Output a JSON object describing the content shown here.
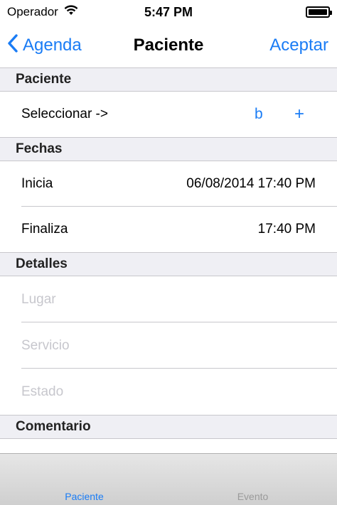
{
  "status_bar": {
    "carrier": "Operador",
    "time": "5:47 PM"
  },
  "nav": {
    "back_label": "Agenda",
    "title": "Paciente",
    "right_label": "Aceptar",
    "accent_color": "#1a7cf5"
  },
  "sections": {
    "paciente": {
      "header": "Paciente",
      "select_label": "Seleccionar ->",
      "action_b": "b",
      "action_plus": "+"
    },
    "fechas": {
      "header": "Fechas",
      "rows": [
        {
          "label": "Inicia",
          "value": "06/08/2014 17:40 PM"
        },
        {
          "label": "Finaliza",
          "value": "17:40 PM"
        }
      ]
    },
    "detalles": {
      "header": "Detalles",
      "placeholders": [
        "Lugar",
        "Servicio",
        "Estado"
      ]
    },
    "comentario": {
      "header": "Comentario"
    }
  },
  "tabs": [
    {
      "label": "Paciente",
      "active": true
    },
    {
      "label": "Evento",
      "active": false
    }
  ]
}
